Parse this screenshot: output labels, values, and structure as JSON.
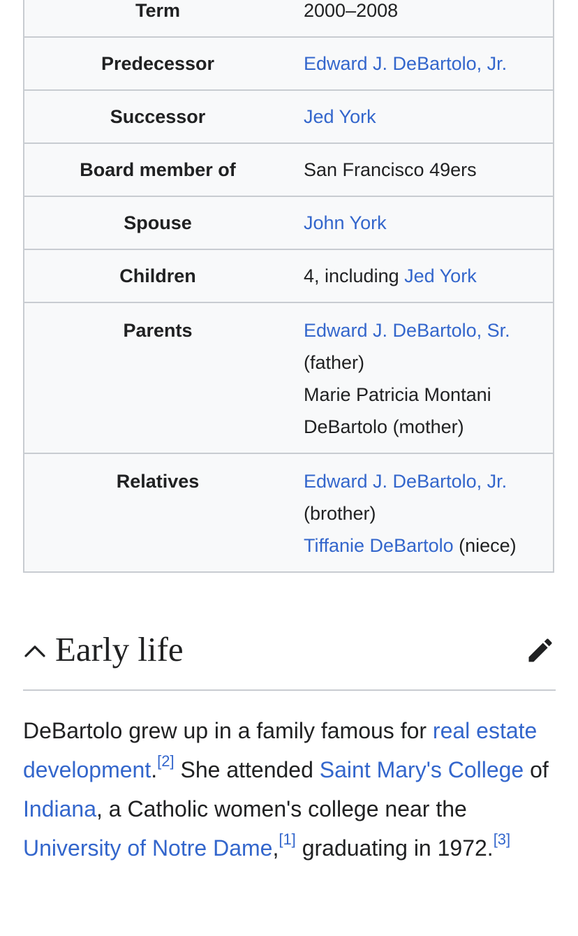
{
  "infobox": {
    "term": {
      "label": "Term",
      "value": "2000–2008"
    },
    "predecessor": {
      "label": "Predecessor",
      "value": "Edward J. DeBartolo, Jr."
    },
    "successor": {
      "label": "Successor",
      "value": "Jed York"
    },
    "board": {
      "label": "Board member of",
      "value": "San Francisco 49ers"
    },
    "spouse": {
      "label": "Spouse",
      "value": "John York"
    },
    "children": {
      "label": "Children",
      "prefix": "4, including ",
      "link": "Jed York"
    },
    "parents": {
      "label": "Parents",
      "father_link": "Edward J. DeBartolo, Sr.",
      "father_note": "(father)",
      "mother_line1": "Marie Patricia Montani",
      "mother_line2": "DeBartolo (mother)"
    },
    "relatives": {
      "label": "Relatives",
      "brother_link": "Edward J. DeBartolo, Jr.",
      "brother_note": "(brother)",
      "niece_link": "Tiffanie DeBartolo",
      "niece_note": " (niece)"
    }
  },
  "section": {
    "title": "Early life",
    "chevron_icon": "chevron-up-icon",
    "edit_icon": "pencil-icon"
  },
  "paragraph": {
    "t1": "DeBartolo grew up in a family famous for ",
    "l1": "real estate development",
    "t2": ".",
    "r2": "[2]",
    "t3": " She attended ",
    "l2": "Saint Mary's College",
    "t4": " of ",
    "l3": "Indiana",
    "t5": ", a Catholic women's college near the ",
    "l4": "University of Notre Dame",
    "t6": ",",
    "r1": "[1]",
    "t7": " graduating in 1972.",
    "r3": "[3]"
  },
  "colors": {
    "link": "#3366cc",
    "text": "#202122",
    "border": "#c8ccd1",
    "infobox_bg": "#f8f9fa"
  }
}
